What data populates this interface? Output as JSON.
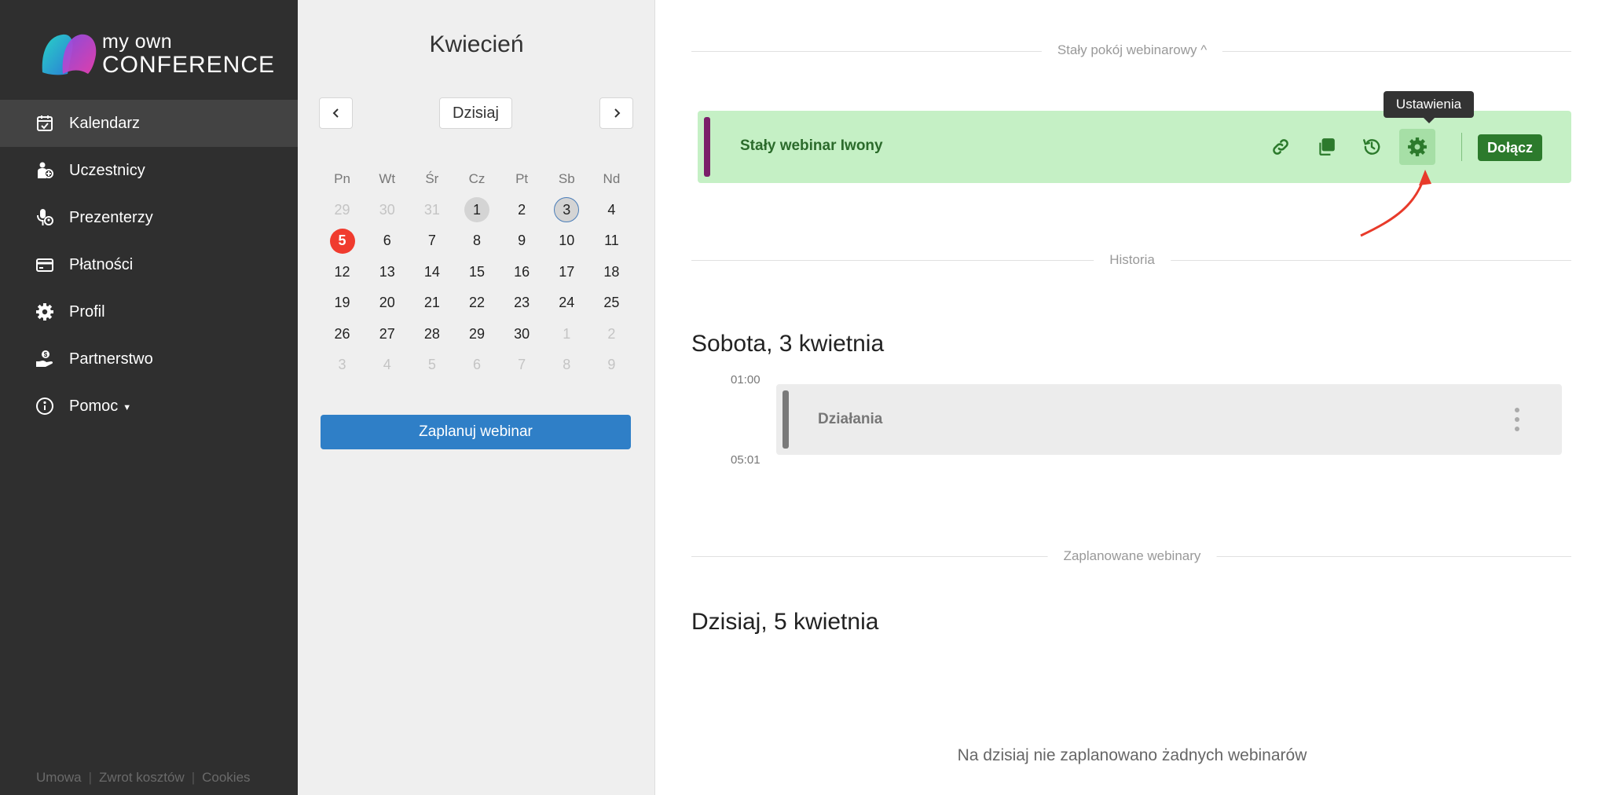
{
  "brand": {
    "line1": "my own",
    "line2": "CONFERENCE"
  },
  "nav": [
    {
      "label": "Kalendarz",
      "icon": "calendar-check-icon"
    },
    {
      "label": "Uczestnicy",
      "icon": "add-user-icon"
    },
    {
      "label": "Prezenterzy",
      "icon": "microphone-user-icon"
    },
    {
      "label": "Płatności",
      "icon": "credit-card-icon"
    },
    {
      "label": "Profil",
      "icon": "gear-icon"
    },
    {
      "label": "Partnerstwo",
      "icon": "hand-coin-icon"
    },
    {
      "label": "Pomoc",
      "icon": "info-icon"
    }
  ],
  "footer": {
    "link1": "Umowa",
    "link2": "Zwrot kosztów",
    "link3": "Cookies"
  },
  "calendar": {
    "month": "Kwiecień",
    "today_label": "Dzisiaj",
    "weekdays": [
      "Pn",
      "Wt",
      "Śr",
      "Cz",
      "Pt",
      "Sb",
      "Nd"
    ],
    "weeks": [
      [
        "29",
        "30",
        "31",
        "1",
        "2",
        "3",
        "4"
      ],
      [
        "5",
        "6",
        "7",
        "8",
        "9",
        "10",
        "11"
      ],
      [
        "12",
        "13",
        "14",
        "15",
        "16",
        "17",
        "18"
      ],
      [
        "19",
        "20",
        "21",
        "22",
        "23",
        "24",
        "25"
      ],
      [
        "26",
        "27",
        "28",
        "29",
        "30",
        "1",
        "2"
      ],
      [
        "3",
        "4",
        "5",
        "6",
        "7",
        "8",
        "9"
      ]
    ],
    "schedule_button": "Zaplanuj webinar"
  },
  "main": {
    "permanent_room_label": "Stały pokój webinarowy ^",
    "room": {
      "title": "Stały webinar Iwony",
      "join": "Dołącz",
      "tooltip": "Ustawienia"
    },
    "history_label": "Historia",
    "history_day": "Sobota, 3 kwietnia",
    "event": {
      "start": "01:00",
      "end": "05:01",
      "title": "Działania"
    },
    "scheduled_label": "Zaplanowane webinary",
    "today_heading": "Dzisiaj, 5 kwietnia",
    "empty_message": "Na dzisiaj nie zaplanowano żadnych webinarów"
  },
  "colors": {
    "sidebar": "#2f2f2f",
    "accent_blue": "#2f7fc7",
    "room_green": "#c5f0c5",
    "join_green": "#2c7a2c",
    "today_red": "#f03b2e",
    "room_stripe": "#7b1f6a"
  }
}
